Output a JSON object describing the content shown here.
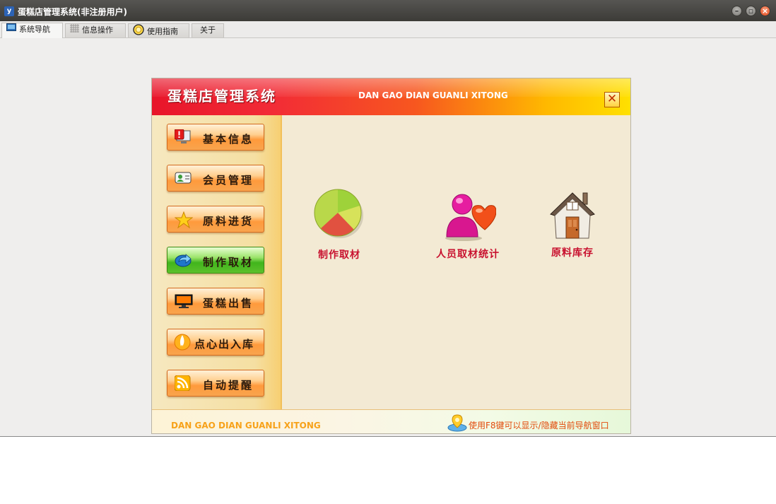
{
  "window": {
    "title": "蛋糕店管理系统(非注册用户)",
    "app_icon_glyph": "y"
  },
  "tabs": [
    {
      "label": "系统导航",
      "icon": "monitor-icon",
      "active": true
    },
    {
      "label": "信息操作",
      "icon": "grid-icon",
      "active": false
    },
    {
      "label": "使用指南",
      "icon": "help-icon",
      "active": false
    },
    {
      "label": "关于",
      "icon": "",
      "active": false
    }
  ],
  "banner": {
    "title": "蛋糕店管理系统",
    "subtitle": "DAN GAO DIAN GUANLI XITONG",
    "close_glyph": "✕"
  },
  "sidebar": {
    "items": [
      {
        "label": "基本信息",
        "icon": "alert-monitor-icon"
      },
      {
        "label": "会员管理",
        "icon": "member-card-icon"
      },
      {
        "label": "原料进货",
        "icon": "star-icon"
      },
      {
        "label": "制作取材",
        "icon": "arrow-icon",
        "highlight": true
      },
      {
        "label": "蛋糕出售",
        "icon": "display-icon"
      },
      {
        "label": "点心出入库",
        "icon": "flame-icon"
      },
      {
        "label": "自动提醒",
        "icon": "rss-icon"
      }
    ]
  },
  "content": {
    "items": [
      {
        "label": "制作取材",
        "icon": "pie-chart-icon"
      },
      {
        "label": "人员取材统计",
        "icon": "user-heart-icon"
      },
      {
        "label": "原料库存",
        "icon": "house-icon"
      }
    ]
  },
  "footer": {
    "left_text": "DAN GAO DIAN GUANLI XITONG",
    "hint": "使用F8键可以显示/隐藏当前导航窗口"
  },
  "colors": {
    "accent_red": "#c8102e",
    "nav_orange": "#ff9a3c",
    "nav_green": "#41b51c",
    "footer_orange": "#f7a21a"
  }
}
